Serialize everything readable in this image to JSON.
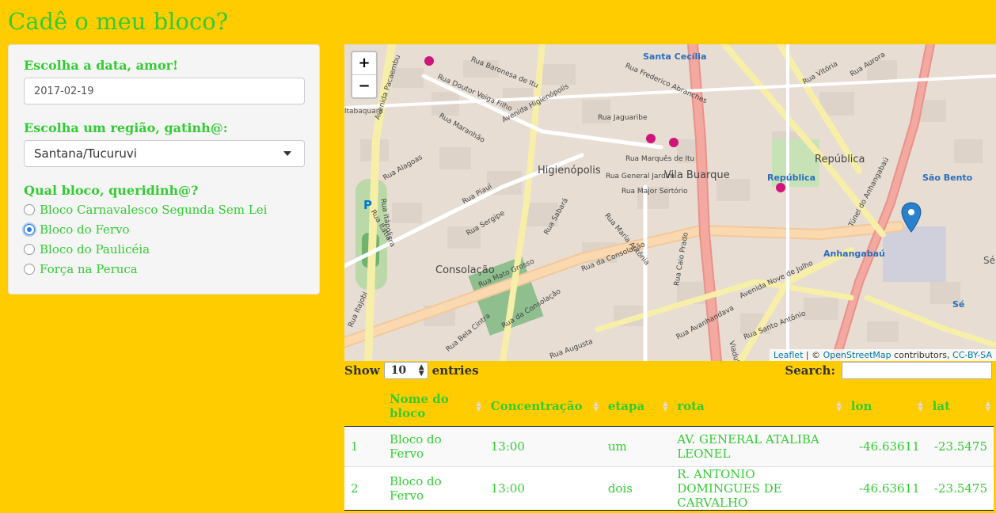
{
  "app": {
    "title": "Cadê o meu bloco?",
    "colors": {
      "background": "#FFCC00",
      "text": "#33CC33",
      "link": "#0078A8"
    }
  },
  "sidebar": {
    "date_label": "Escolha a data, amor!",
    "date_value": "2017-02-19",
    "region_label": "Escolha um região, gatinh@:",
    "region_value": "Santana/Tucuruvi",
    "bloco_label": "Qual bloco, queridinh@?",
    "bloco_options": [
      {
        "label": "Bloco Carnavalesco Segunda Sem Lei",
        "checked": false
      },
      {
        "label": "Bloco do Fervo",
        "checked": true
      },
      {
        "label": "Bloco do Paulicéia",
        "checked": false
      },
      {
        "label": "Força na Peruca",
        "checked": false
      }
    ]
  },
  "map": {
    "zoom_in": "+",
    "zoom_out": "−",
    "attribution": {
      "leaflet": "Leaflet",
      "sep": " | © ",
      "osm": "OpenStreetMap",
      "contrib": " contributors, ",
      "license": "CC-BY-SA"
    },
    "labels": {
      "santa_cecilia": "Santa Cecília",
      "higienopolis": "Higienópolis",
      "vila_buarque": "Vila Buarque",
      "republica_area": "República",
      "republica_station": "República",
      "sao_bento": "São Bento",
      "anhangabau": "Anhangabaú",
      "consolacao": "Consolação",
      "se": "Sé",
      "tabaquara": "ltabaquara",
      "se_edge": "Sé"
    },
    "streets": {
      "pacaembu": "Avenida Pacaembu",
      "veiga_filho": "Rua Doutor Veiga Filho",
      "baronesa": "Rua Baronesa de Itu",
      "fred_abranches": "Rua Frederico Abranches",
      "jaguaribe": "Rua Jaguaribe",
      "higienopolis_av": "Avenida Higienópolis",
      "maranhao": "Rua Maranhão",
      "piaui": "Rua Piauí",
      "alagoas": "Rua Alagoas",
      "itatiara": "Rua Itatiara",
      "itapolis": "Rua Itápolis",
      "sergipe": "Rua Sergipe",
      "sabara": "Rua Sabará",
      "consolacao_rua": "Rua da Consolação",
      "consolacao_rua2": "Rua da Consolação",
      "nove_julho": "Avenida Nove de Julho",
      "tunel": "Túnel do Anhangabaú",
      "major_sertorio": "Rua Major Sertório",
      "marques_itu": "Rua Marquês de Itu",
      "general_jardim": "Rua General Jardim",
      "augusta": "Rua Augusta",
      "mato_grosso": "Rua Mato Grosso",
      "itajobi": "Rua Itajobi",
      "caio_prado": "Rua Caio Prado",
      "santo_antonio": "Rua Santo Antônio",
      "aurora": "Rua Aurora",
      "vitoria": "Rua Vitória",
      "maria_antonia": "Rua Maria Antônia",
      "bela_cintra": "Rua Bela Cintra",
      "viaduto": "Viaduto",
      "avanhandava": "Rua Avanhandava"
    }
  },
  "table": {
    "show_label": "Show",
    "entries_label": "entries",
    "page_length": "10",
    "search_label": "Search:",
    "columns": [
      "",
      "Nome do bloco",
      "Concentração",
      "etapa",
      "rota",
      "lon",
      "lat"
    ],
    "rows": [
      [
        "1",
        "Bloco do Fervo",
        "13:00",
        "um",
        "AV. GENERAL ATALIBA LEONEL",
        "-46.63611",
        "-23.5475"
      ],
      [
        "2",
        "Bloco do Fervo",
        "13:00",
        "dois",
        "R. ANTONIO DOMINGUES DE CARVALHO",
        "-46.63611",
        "-23.5475"
      ]
    ]
  }
}
